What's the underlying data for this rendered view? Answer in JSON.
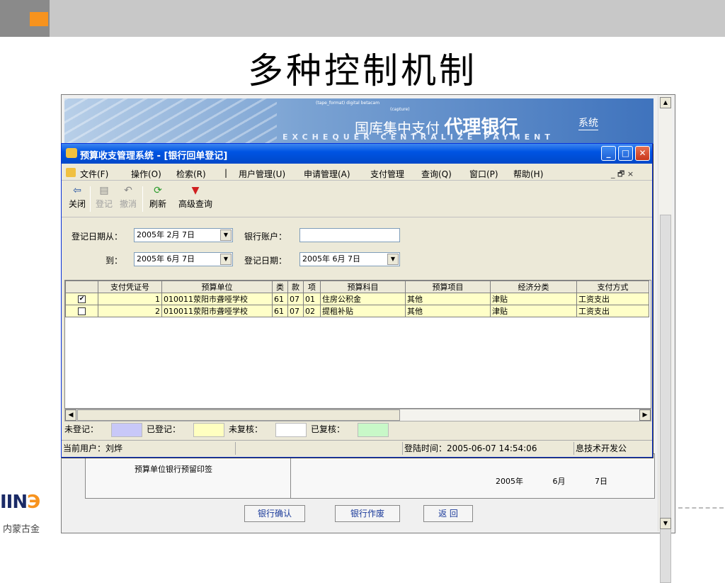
{
  "slide": {
    "title": "多种控制机制",
    "logo_text": "IIN",
    "logo_accent": "Э",
    "logo_sub": "内蒙古金"
  },
  "banner": {
    "small_text": "(tape_format) digital betacam",
    "small_text2": "(capture)",
    "cn_title_part1": "国库集中支付",
    "cn_title_part2": "代理银行",
    "cn_sys": "系统",
    "en_title": "EXCHEQUER CENTRALIZE PAYMENT"
  },
  "window": {
    "title": "预算收支管理系统 - [银行回单登记]"
  },
  "menu": {
    "items": [
      "文件(F)",
      "操作(O)",
      "检索(R)",
      "|",
      "用户管理(U)",
      "申请管理(A)",
      "支付管理",
      "查询(Q)",
      "窗口(P)",
      "帮助(H)"
    ],
    "mdi_controls": "_ 🗗 ×"
  },
  "toolbar": {
    "close": "关闭",
    "register": "登记",
    "revoke": "撤消",
    "refresh": "刷新",
    "advanced_query": "高级查询"
  },
  "form": {
    "date_from_label": "登记日期从：",
    "date_from_value": "2005年 2月 7日",
    "to_label": "到：",
    "date_to_value": "2005年 6月 7日",
    "bank_account_label": "银行账户：",
    "bank_account_value": "",
    "reg_date_label": "登记日期：",
    "reg_date_value": "2005年 6月 7日"
  },
  "grid": {
    "headers": [
      "",
      "支付凭证号",
      "预算单位",
      "类",
      "款",
      "项",
      "预算科目",
      "预算项目",
      "经济分类",
      "支付方式"
    ],
    "rows": [
      {
        "checked": true,
        "voucher": "1",
        "unit": "010011荥阳市聋哑学校",
        "cls": "61",
        "kuan": "07",
        "xiang": "01",
        "subject": "住房公积金",
        "project": "其他",
        "econ": "津贴",
        "pay": "工资支出"
      },
      {
        "checked": false,
        "voucher": "2",
        "unit": "010011荥阳市聋哑学校",
        "cls": "61",
        "kuan": "07",
        "xiang": "02",
        "subject": "提租补贴",
        "project": "其他",
        "econ": "津贴",
        "pay": "工资支出"
      }
    ]
  },
  "legend": {
    "unregistered": "未登记：",
    "registered": "已登记：",
    "unreviewed": "未复核：",
    "reviewed": "已复核：",
    "colors": {
      "unregistered": "#c8c8f8",
      "registered": "#ffffc0",
      "unreviewed": "#ffffff",
      "reviewed": "#c8f8c8"
    }
  },
  "status": {
    "current_user": "当前用户：刘烨",
    "login_time": "登陆时间：2005-06-07 14:54:06",
    "company": "息技术开发公"
  },
  "background": {
    "seal_label": "预算单位银行预留印签",
    "year": "2005年",
    "month": "6月",
    "day": "7日",
    "btn_confirm": "银行确认",
    "btn_void": "银行作废",
    "btn_back": "返 回"
  }
}
